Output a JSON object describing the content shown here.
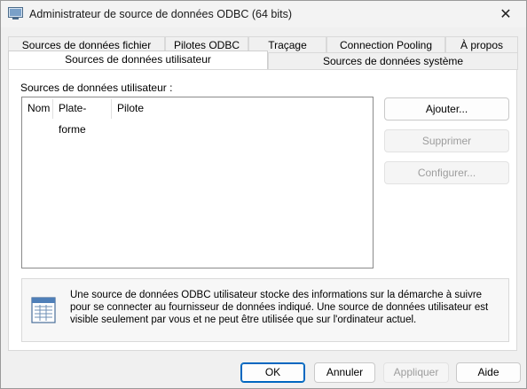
{
  "window": {
    "title": "Administrateur de source de données ODBC (64 bits)",
    "close_glyph": "✕"
  },
  "tabs": {
    "row1": [
      {
        "label": "Sources de données fichier"
      },
      {
        "label": "Pilotes ODBC"
      },
      {
        "label": "Traçage"
      },
      {
        "label": "Connection Pooling"
      },
      {
        "label": "À propos"
      }
    ],
    "row2": [
      {
        "label": "Sources de données utilisateur",
        "selected": true
      },
      {
        "label": "Sources de données système"
      }
    ]
  },
  "panel": {
    "section_label": "Sources de données utilisateur :",
    "list_columns": [
      "Nom",
      "Plate-forme",
      "Pilote"
    ],
    "rows": [],
    "buttons": {
      "add": "Ajouter...",
      "remove": "Supprimer",
      "configure": "Configurer..."
    },
    "info_text": "Une source de données ODBC utilisateur stocke des informations sur la démarche à suivre pour se connecter au fournisseur de données indiqué. Une source de données utilisateur est visible seulement par vous et ne peut être utilisée que sur l'ordinateur actuel."
  },
  "footer": {
    "ok": "OK",
    "cancel": "Annuler",
    "apply": "Appliquer",
    "help": "Aide"
  },
  "icons": {
    "app": "odbc-admin-icon",
    "info": "datasource-info-icon",
    "close": "close-icon"
  },
  "colors": {
    "accent": "#0067c0",
    "disabled_text": "#9d9d9d"
  }
}
